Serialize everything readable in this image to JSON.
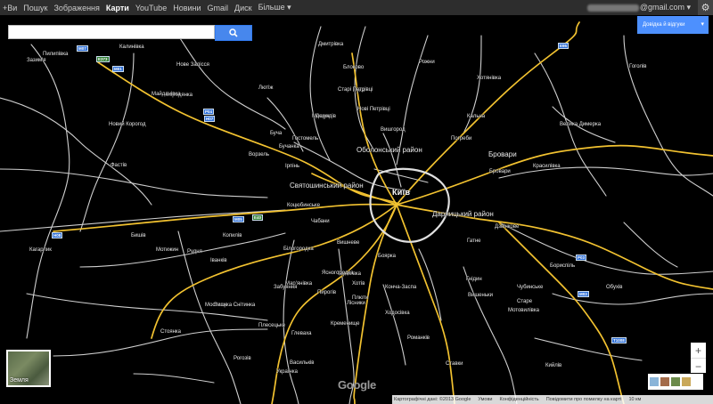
{
  "gbar": {
    "items": [
      "+Ви",
      "Пошук",
      "Зображення",
      "Карти",
      "YouTube",
      "Новини",
      "Gmail",
      "Диск",
      "Більше ▾"
    ],
    "active_index": 3,
    "account": "@gmail.com ▾"
  },
  "search": {
    "value": "",
    "button_icon": "search-icon"
  },
  "help_button": {
    "label": "Довідка й відгуки",
    "icon": "chevron-down-icon"
  },
  "earth": {
    "label": "Земля"
  },
  "zoom": {
    "in": "+",
    "out": "−"
  },
  "logo": "Google",
  "attribution": {
    "map_data": "Картографічні дані: ©2013 Google",
    "terms": "Умови",
    "privacy": "Конфіденційність",
    "report": "Повідомити про помилку на карті",
    "scale": "10 км"
  },
  "colors": {
    "map_bg": "#000000",
    "major_road": "#f2c230",
    "minor_road": "#c8c8c8",
    "shield": "#2f6fd6",
    "search_btn": "#4787ed",
    "help_btn": "#4d90fe"
  },
  "districts": [
    "Оболонський район",
    "Святошинський район",
    "Київ",
    "Дарницький район",
    "Бровари"
  ],
  "labels": [
    "Дмитрівка",
    "Блоково",
    "Нове Залісся",
    "Лютіж",
    "Демидів",
    "Лука",
    "Хотянівка",
    "Рожни",
    "Вишгород",
    "Нові Петрівці",
    "Старі Петрівці",
    "Бородянка",
    "Пилипівка",
    "Майданівка",
    "Ворзель",
    "Бучанка",
    "Ірпінь",
    "Буча",
    "Гостомель",
    "Бровари",
    "Красилівка",
    "Новий Корогод",
    "Мощун",
    "Кальна",
    "Погреби",
    "Зазим'я",
    "Калинівка",
    "Велика Димерка",
    "Гоголів",
    "Коцюбинське",
    "Фастів",
    "Кагарлик",
    "Вишневе",
    "Боярка",
    "Чабани",
    "Бориспіль",
    "Тарасівка",
    "Хотів",
    "Пирогів",
    "Гнідин",
    "Бишів",
    "Копилів",
    "Ясногородка",
    "Мотижин",
    "Мар'янівка",
    "Лісники",
    "Ходосівка",
    "Конча-Заспа",
    "Вишеньки",
    "Чубинське",
    "Романків",
    "Глеваха",
    "Гатне",
    "Кременище",
    "Велика Снітинка",
    "Мостище",
    "Плесецьке",
    "Дзвінкове",
    "Мотовилівка",
    "Українка",
    "Васильків",
    "Плюти",
    "Обухів",
    "Ставки",
    "Старе",
    "Кийлів",
    "Рогозів",
    "Іванків",
    "Рудня",
    "Стоянка",
    "Забуяння",
    "Білогородка"
  ],
  "shields": [
    "М07",
    "Е373",
    "М01",
    "Е95",
    "Н07",
    "Р04",
    "М05",
    "Е40",
    "Н08",
    "Р03",
    "М03",
    "Т1008"
  ]
}
